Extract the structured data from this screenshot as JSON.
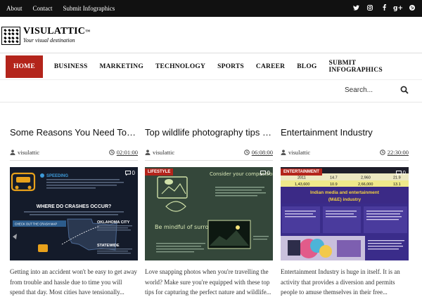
{
  "topbar": {
    "links": [
      "About",
      "Contact",
      "Submit Infographics"
    ],
    "social": [
      "twitter-icon",
      "instagram-icon",
      "facebook-icon",
      "google-plus-icon",
      "pinterest-icon"
    ]
  },
  "logo": {
    "name": "VISULATTIC",
    "tm": "™",
    "tagline": "Your visual destination"
  },
  "nav": {
    "items": [
      "HOME",
      "BUSINESS",
      "MARKETING",
      "TECHNOLOGY",
      "SPORTS",
      "CAREER",
      "BLOG",
      "SUBMIT INFOGRAPHICS"
    ],
    "active_color": "#b3241b"
  },
  "search": {
    "placeholder": "Search..."
  },
  "posts": [
    {
      "title": "Some Reasons You Need To K…",
      "author": "visulattic",
      "time": "02:01:00",
      "comments": "0",
      "image": {
        "heading1": "SPEEDING",
        "heading2": "WHERE DO CRASHES OCCUR?",
        "label1": "OKLAHOMA CITY",
        "label2": "STATEWIDE",
        "button": "CHECK OUT THE CRASH MAP"
      },
      "excerpt": "Getting into an accident won't be easy to get away from trouble and hassle due to time you will spend that day. Most cities have tensionally..."
    },
    {
      "title": "Top wildlife photography tips for…",
      "author": "visulattic",
      "time": "06:08:00",
      "comments": "0",
      "image": {
        "category": "LIFESTYLE",
        "heading1": "Consider your composition",
        "heading2": "Be mindful of surroundings"
      },
      "excerpt": "Love snapping photos when you're travelling the world? Make sure you're equipped with these top tips for capturing the perfect nature and wildlife..."
    },
    {
      "title": "Entertainment Industry",
      "author": "visulattic",
      "time": "22:30:00",
      "comments": "0",
      "image": {
        "category": "ENTERTAINMENT",
        "banner": "Indian media and entertainment (M&E) industry",
        "row": [
          "2011",
          "14.7",
          "2,960",
          "21.9"
        ],
        "row2": [
          "1,43,600",
          "10.9",
          "2,66,000",
          "13.1"
        ]
      },
      "excerpt": "Entertainment Industry is huge in itself. It is an activity that provides a diversion and permits people to amuse themselves in their free..."
    }
  ]
}
